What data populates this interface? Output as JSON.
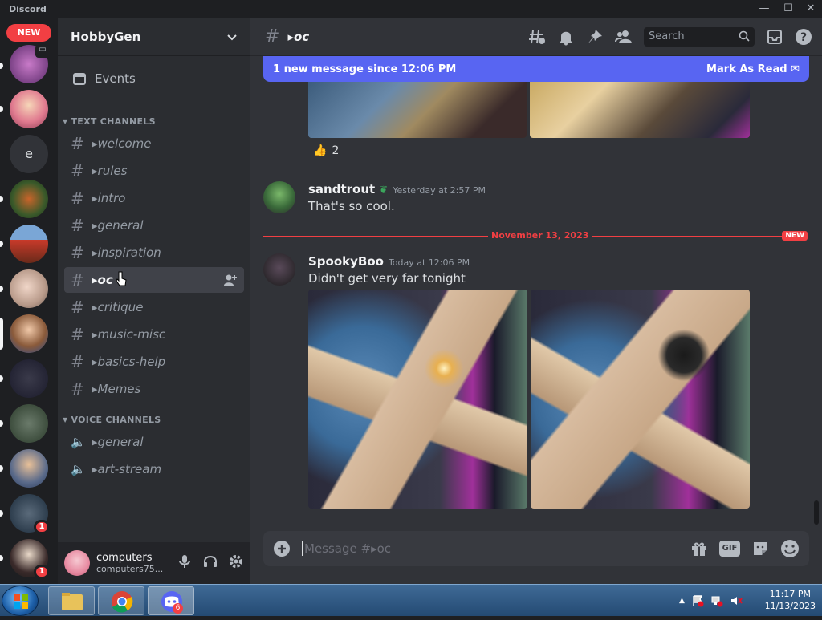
{
  "window": {
    "app_name": "Discord"
  },
  "rail": {
    "new_label": "NEW",
    "letter_server": "e",
    "badges": [
      "1",
      "1"
    ]
  },
  "sidebar": {
    "guild_name": "HobbyGen",
    "events_label": "Events",
    "text_category": "TEXT CHANNELS",
    "text_channels": [
      "▸welcome",
      "▸rules",
      "▸intro",
      "▸general",
      "▸inspiration",
      "▸oc",
      "▸critique",
      "▸music-misc",
      "▸basics-help",
      "▸Memes"
    ],
    "selected_channel": "▸oc",
    "voice_category": "VOICE CHANNELS",
    "voice_channels": [
      "▸general",
      "▸art-stream"
    ]
  },
  "user": {
    "display_name": "computers",
    "username": "computers75..."
  },
  "header": {
    "channel_name": "▸oc",
    "search_placeholder": "Search"
  },
  "banner": {
    "text": "1 new message since 12:06 PM",
    "action": "Mark As Read"
  },
  "messages": [
    {
      "author": "sandtrout",
      "timestamp": "Yesterday at 2:57 PM",
      "text": "That's so cool."
    },
    {
      "author": "SpookyBoo",
      "timestamp": "Today at 12:06 PM",
      "text": "Didn't get very far tonight"
    }
  ],
  "reaction": {
    "emoji": "👍",
    "count": "2"
  },
  "divider": {
    "date": "November 13, 2023",
    "new_tag": "NEW"
  },
  "composer": {
    "placeholder": "Message #▸oc",
    "gif_label": "GIF"
  },
  "taskbar": {
    "time": "11:17 PM",
    "date": "11/13/2023",
    "discord_badge": "6"
  },
  "colors": {
    "blurple": "#5865f2",
    "red": "#f23f43",
    "bg_main": "#313338",
    "bg_sidebar": "#2b2d31",
    "bg_rail": "#1e1f22"
  }
}
